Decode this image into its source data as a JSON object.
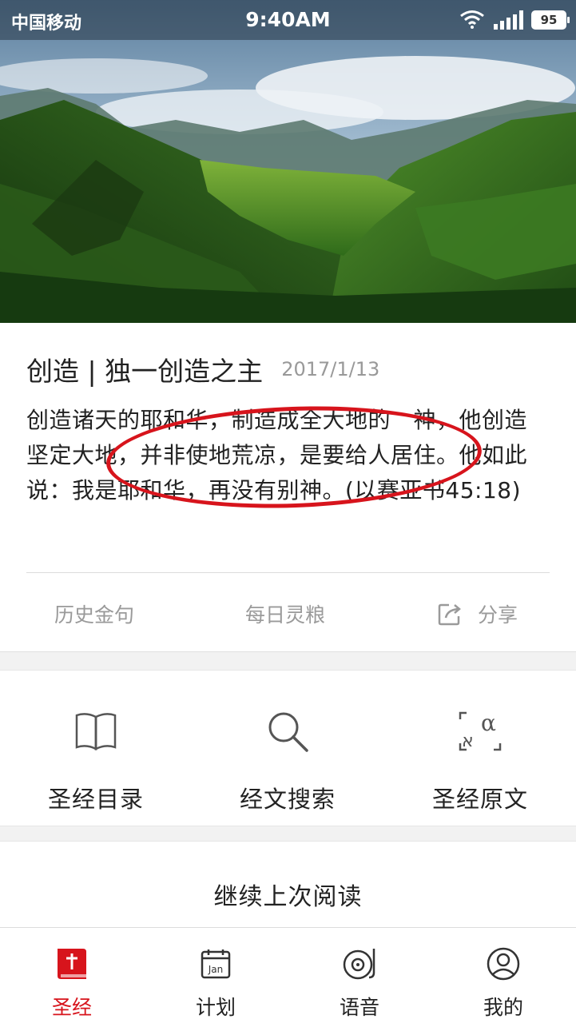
{
  "status_bar": {
    "carrier": "中国移动",
    "time": "9:40AM",
    "battery": "95"
  },
  "verse": {
    "title": "创造 | 独一创造之主",
    "date": "2017/1/13",
    "text": "创造诸天的耶和华，制造成全大地的　神，他创造坚定大地，并非使地荒凉，是要给人居住。他如此说：我是耶和华，再没有别神。(以赛亚书45:18)",
    "actions": {
      "history": "历史金句",
      "daily": "每日灵粮",
      "share": "分享"
    }
  },
  "tools": {
    "catalog": "圣经目录",
    "search": "经文搜索",
    "original": "圣经原文"
  },
  "continue_reading": "继续上次阅读",
  "bottom_nav": {
    "bible": "圣经",
    "plan": "计划",
    "audio": "语音",
    "mine": "我的",
    "calendar_icon_text": "Jan"
  },
  "colors": {
    "accent": "#d7141c",
    "muted_text": "#9a9a9a"
  }
}
